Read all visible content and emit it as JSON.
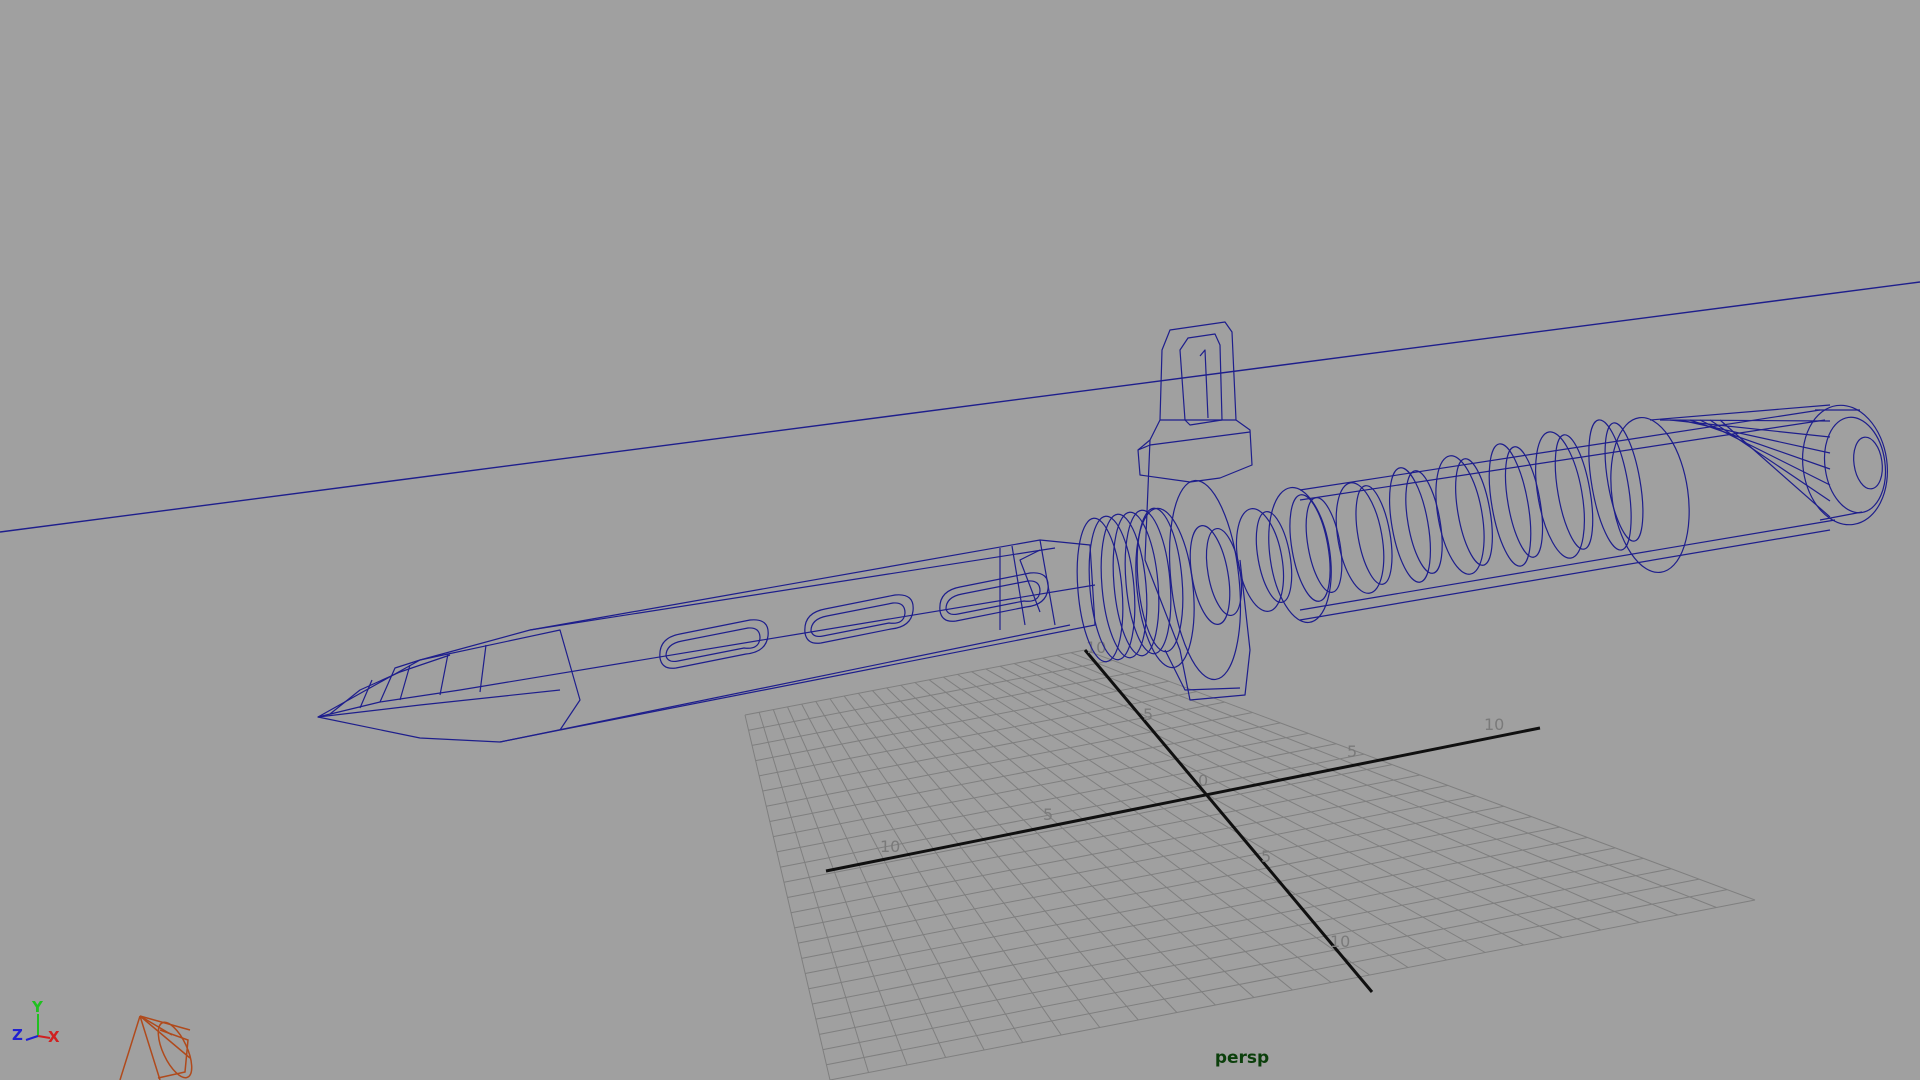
{
  "viewport": {
    "camera_name": "persp",
    "background_color": "#a0a0a0",
    "wireframe_color": "#1e1e8c",
    "grid_color": "#7f7f7f",
    "grid_axis_color": "#101010"
  },
  "grid": {
    "labels": {
      "a_neg10": "10",
      "a_neg5": "5",
      "origin": "0",
      "a_pos5": "5",
      "a_pos10": "10",
      "b_neg10": "10",
      "b_neg5": "5",
      "b_pos5": "5",
      "b_pos10": "10"
    }
  },
  "axis_gizmo": {
    "x_label": "X",
    "y_label": "Y",
    "z_label": "Z",
    "x_color": "#d02020",
    "y_color": "#20c020",
    "z_color": "#2020d0",
    "icon": "view-axis-icon"
  },
  "scene": {
    "model": "knife-wireframe-model",
    "camera_icon": "camera-icon"
  }
}
